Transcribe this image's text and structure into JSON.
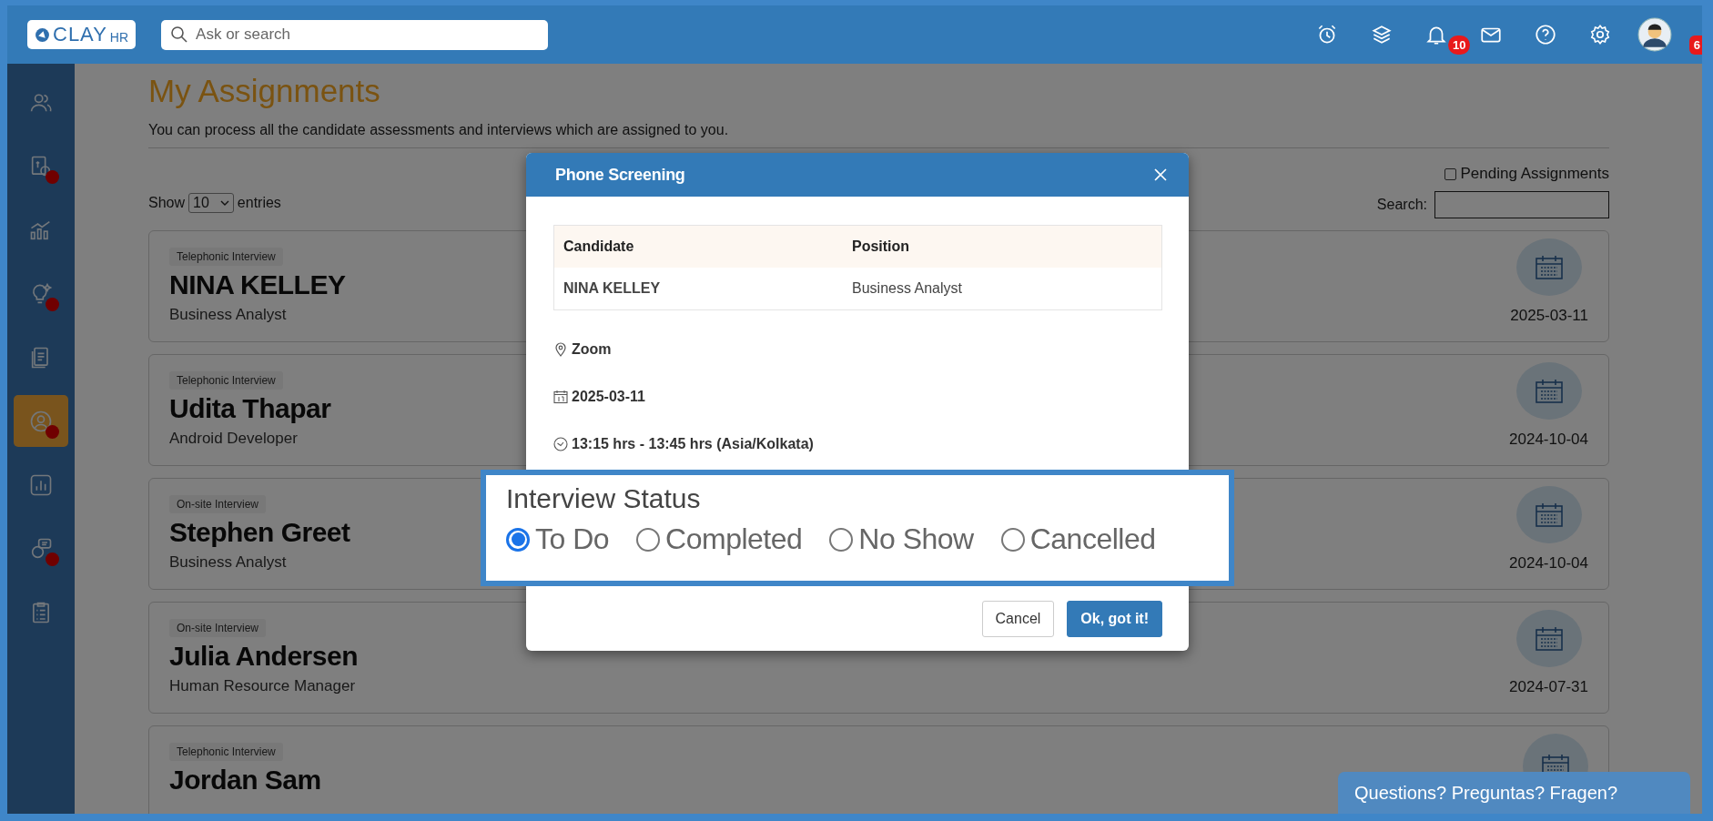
{
  "topbar": {
    "logo": {
      "main": "CLAY",
      "sub": "HR"
    },
    "search": {
      "placeholder": "Ask or search"
    },
    "actions": [
      {
        "kind": "alarm"
      },
      {
        "kind": "layers"
      },
      {
        "kind": "bell",
        "badge": "10"
      },
      {
        "kind": "mail"
      },
      {
        "kind": "help"
      },
      {
        "kind": "settings"
      },
      {
        "kind": "avatar"
      }
    ],
    "edge_badge": "6"
  },
  "sidebar": {
    "items": [
      {
        "kind": "people",
        "selected": false,
        "alert": false
      },
      {
        "kind": "payroll",
        "selected": false,
        "alert": true
      },
      {
        "kind": "growth",
        "selected": false,
        "alert": false
      },
      {
        "kind": "idea",
        "selected": false,
        "alert": true
      },
      {
        "kind": "documents",
        "selected": false,
        "alert": false
      },
      {
        "kind": "person",
        "selected": true,
        "alert": true
      },
      {
        "kind": "report",
        "selected": false,
        "alert": false
      },
      {
        "kind": "assistant",
        "selected": false,
        "alert": true
      },
      {
        "kind": "checklist",
        "selected": false,
        "alert": false
      }
    ]
  },
  "page": {
    "title": "My Assignments",
    "subtitle": "You can process all the candidate assessments and interviews which are assigned to you.",
    "pending_filter": {
      "label": "Pending Assignments",
      "checked": false
    },
    "show": {
      "prefix": "Show",
      "value": "10",
      "suffix": "entries"
    },
    "search": {
      "label": "Search:"
    }
  },
  "assignments": [
    {
      "type": "Telephonic Interview",
      "name": "NINA KELLEY",
      "position": "Business Analyst",
      "date": "2025-03-11"
    },
    {
      "type": "Telephonic Interview",
      "name": "Udita Thapar",
      "position": "Android Developer",
      "date": "2024-10-04"
    },
    {
      "type": "On-site Interview",
      "name": "Stephen Greet",
      "position": "Business Analyst",
      "date": "2024-10-04"
    },
    {
      "type": "On-site Interview",
      "name": "Julia Andersen",
      "position": "Human Resource Manager",
      "date": "2024-07-31"
    },
    {
      "type": "Telephonic Interview",
      "name": "Jordan Sam"
    }
  ],
  "modal": {
    "title": "Phone Screening",
    "table": {
      "columns": [
        "Candidate",
        "Position"
      ],
      "rows": [
        {
          "candidate": "NINA KELLEY",
          "position": "Business Analyst"
        }
      ]
    },
    "location": "Zoom",
    "date": "2025-03-11",
    "time": "13:15 hrs - 13:45 hrs (Asia/Kolkata)",
    "status": {
      "label": "Interview Status",
      "options": [
        {
          "label": "To Do",
          "selected": true
        },
        {
          "label": "Completed",
          "selected": false
        },
        {
          "label": "No Show",
          "selected": false
        },
        {
          "label": "Cancelled",
          "selected": false
        }
      ]
    },
    "buttons": [
      {
        "label": "Cancel",
        "kind": "secondary"
      },
      {
        "label": "Ok, got it!",
        "kind": "primary"
      }
    ]
  },
  "chat": {
    "label": "Questions? Preguntas? Fragen?"
  }
}
